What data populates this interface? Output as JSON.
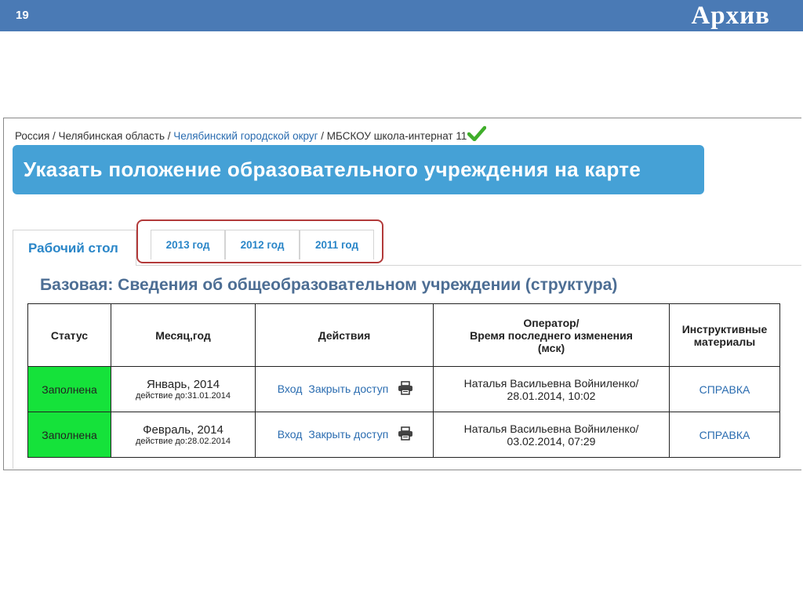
{
  "slide": {
    "number": "19",
    "title": "Архив"
  },
  "breadcrumb": {
    "part1": "Россия / Челябинская область / ",
    "part2": "Челябинский городской округ",
    "part3": " / МБСКОУ школа-интернат 11"
  },
  "map_button": {
    "label": "Указать положение образовательного учреждения на карте"
  },
  "tabs": {
    "main": "Рабочий стол",
    "years": [
      "2013 год",
      "2012 год",
      "2011 год"
    ]
  },
  "section": {
    "title": "Базовая: Сведения об общеобразовательном учреждении (структура)"
  },
  "table": {
    "headers": {
      "status": "Статус",
      "month": "Месяц,год",
      "actions": "Действия",
      "operator_line1": "Оператор/",
      "operator_line2": "Время последнего изменения",
      "operator_line3": "(мск)",
      "materials_line1": "Инструктивные",
      "materials_line2": "материалы"
    },
    "rows": [
      {
        "status": "Заполнена",
        "month": "Январь, 2014",
        "valid": "действие до:31.01.2014",
        "enter": "Вход",
        "close": "Закрыть доступ",
        "operator": "Наталья  Васильевна Войниленко/",
        "time": "28.01.2014, 10:02",
        "help": "СПРАВКА"
      },
      {
        "status": "Заполнена",
        "month": "Февраль, 2014",
        "valid": "действие до:28.02.2014",
        "enter": "Вход",
        "close": "Закрыть доступ",
        "operator": "Наталья  Васильевна Войниленко/",
        "time": "03.02.2014, 07:29",
        "help": "СПРАВКА"
      }
    ]
  },
  "icons": {
    "check": "check-icon",
    "printer": "printer-icon"
  },
  "colors": {
    "header_bar": "#4a7ab5",
    "button": "#45a1d6",
    "status_filled": "#15e23a",
    "highlight": "#b23a3a",
    "link": "#2a6cb0"
  }
}
